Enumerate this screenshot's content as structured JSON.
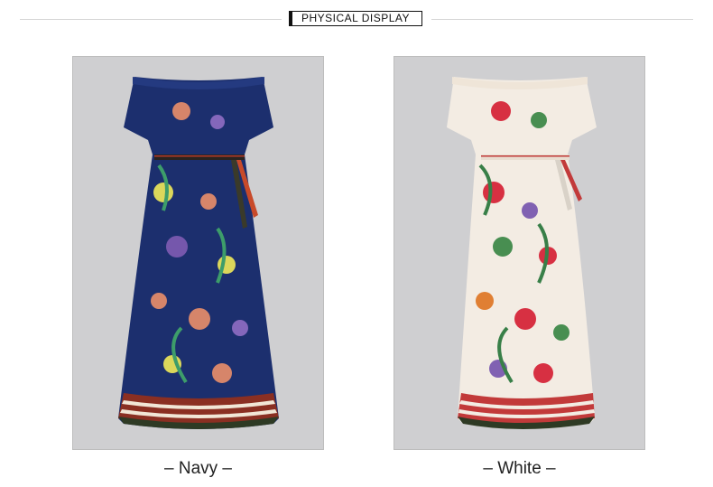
{
  "header": {
    "title": "PHYSICAL DISPLAY"
  },
  "products": [
    {
      "caption": "– Navy –",
      "color_name": "Navy",
      "dress_color": "#1c2f6e",
      "icon": "dress-photo"
    },
    {
      "caption": "– White –",
      "color_name": "White",
      "dress_color": "#f3ece3",
      "icon": "dress-photo"
    }
  ],
  "colors": {
    "card_background": "#cfcfd1",
    "rule": "#d6d6d6",
    "text": "#222222"
  }
}
